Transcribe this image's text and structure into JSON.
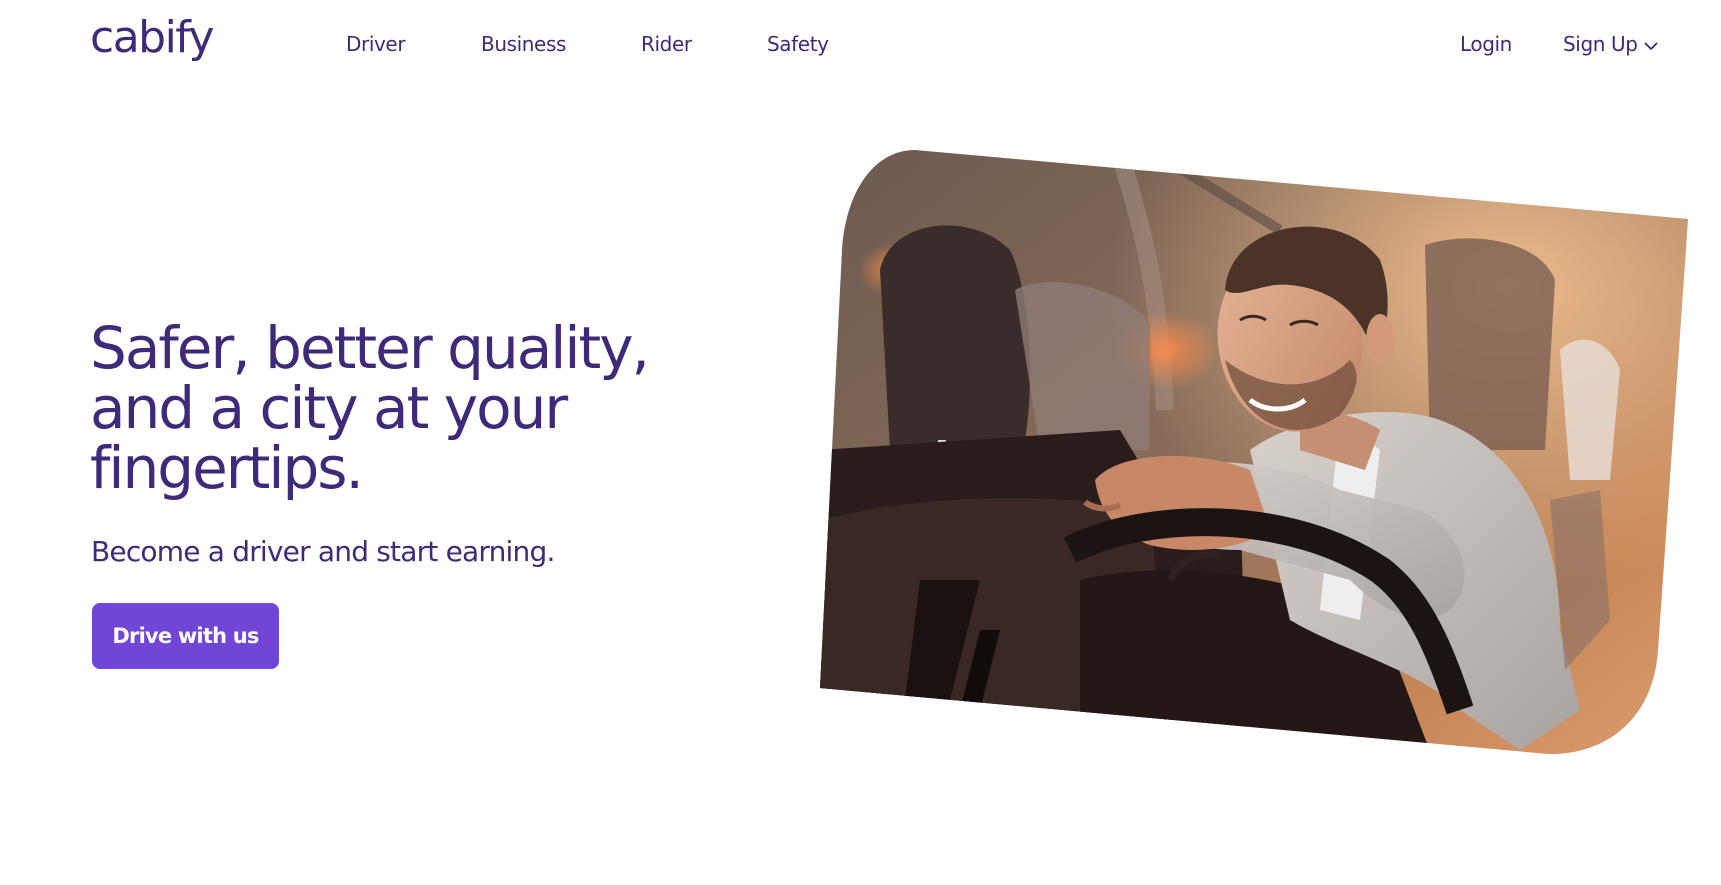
{
  "brand": {
    "logo_text": "cabify",
    "primary_color": "#3f2a79",
    "accent_color": "#7145d6"
  },
  "nav": {
    "items": [
      {
        "label": "Driver"
      },
      {
        "label": "Business"
      },
      {
        "label": "Rider"
      },
      {
        "label": "Safety"
      }
    ],
    "login_label": "Login",
    "signup_label": "Sign Up",
    "signup_icon": "chevron-down-icon"
  },
  "hero": {
    "headline_line1": "Safer, better quality,",
    "headline_line2": "and a city at your",
    "headline_line3": "fingertips.",
    "subline": "Become a driver and start earning.",
    "cta_label": "Drive with us"
  }
}
